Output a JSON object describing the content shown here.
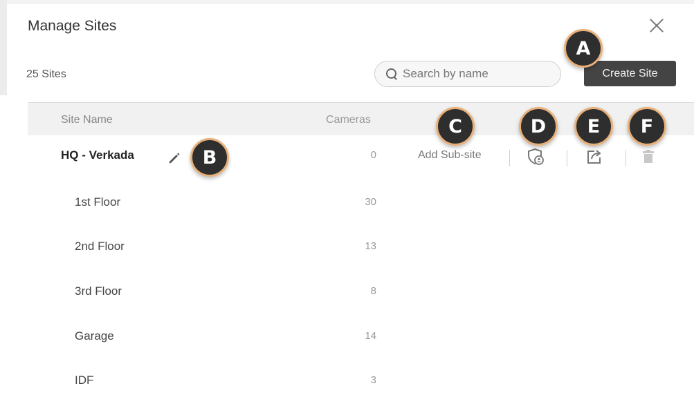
{
  "dialog": {
    "title": "Manage Sites",
    "site_count": "25 Sites",
    "search_placeholder": "Search by name",
    "create_button": "Create Site"
  },
  "table": {
    "columns": [
      "Site Name",
      "Cameras"
    ],
    "rows": [
      {
        "name": "HQ - Verkada",
        "cameras": "0",
        "level": "parent"
      },
      {
        "name": "1st Floor",
        "cameras": "30",
        "level": "child"
      },
      {
        "name": "2nd Floor",
        "cameras": "13",
        "level": "child"
      },
      {
        "name": "3rd Floor",
        "cameras": "8",
        "level": "child"
      },
      {
        "name": "Garage",
        "cameras": "14",
        "level": "child"
      },
      {
        "name": "IDF",
        "cameras": "3",
        "level": "child"
      }
    ],
    "row_actions": {
      "add_subsite": "Add Sub-site",
      "icons": [
        "pencil-icon",
        "shield-user-icon",
        "share-icon",
        "trash-icon"
      ]
    }
  },
  "callouts": [
    "A",
    "B",
    "C",
    "D",
    "E",
    "F"
  ],
  "colors": {
    "primary_button": "#444444",
    "callout_fill": "#2e2e2e",
    "callout_border": "#e8b07a",
    "header_bg": "#f1f1f1"
  }
}
